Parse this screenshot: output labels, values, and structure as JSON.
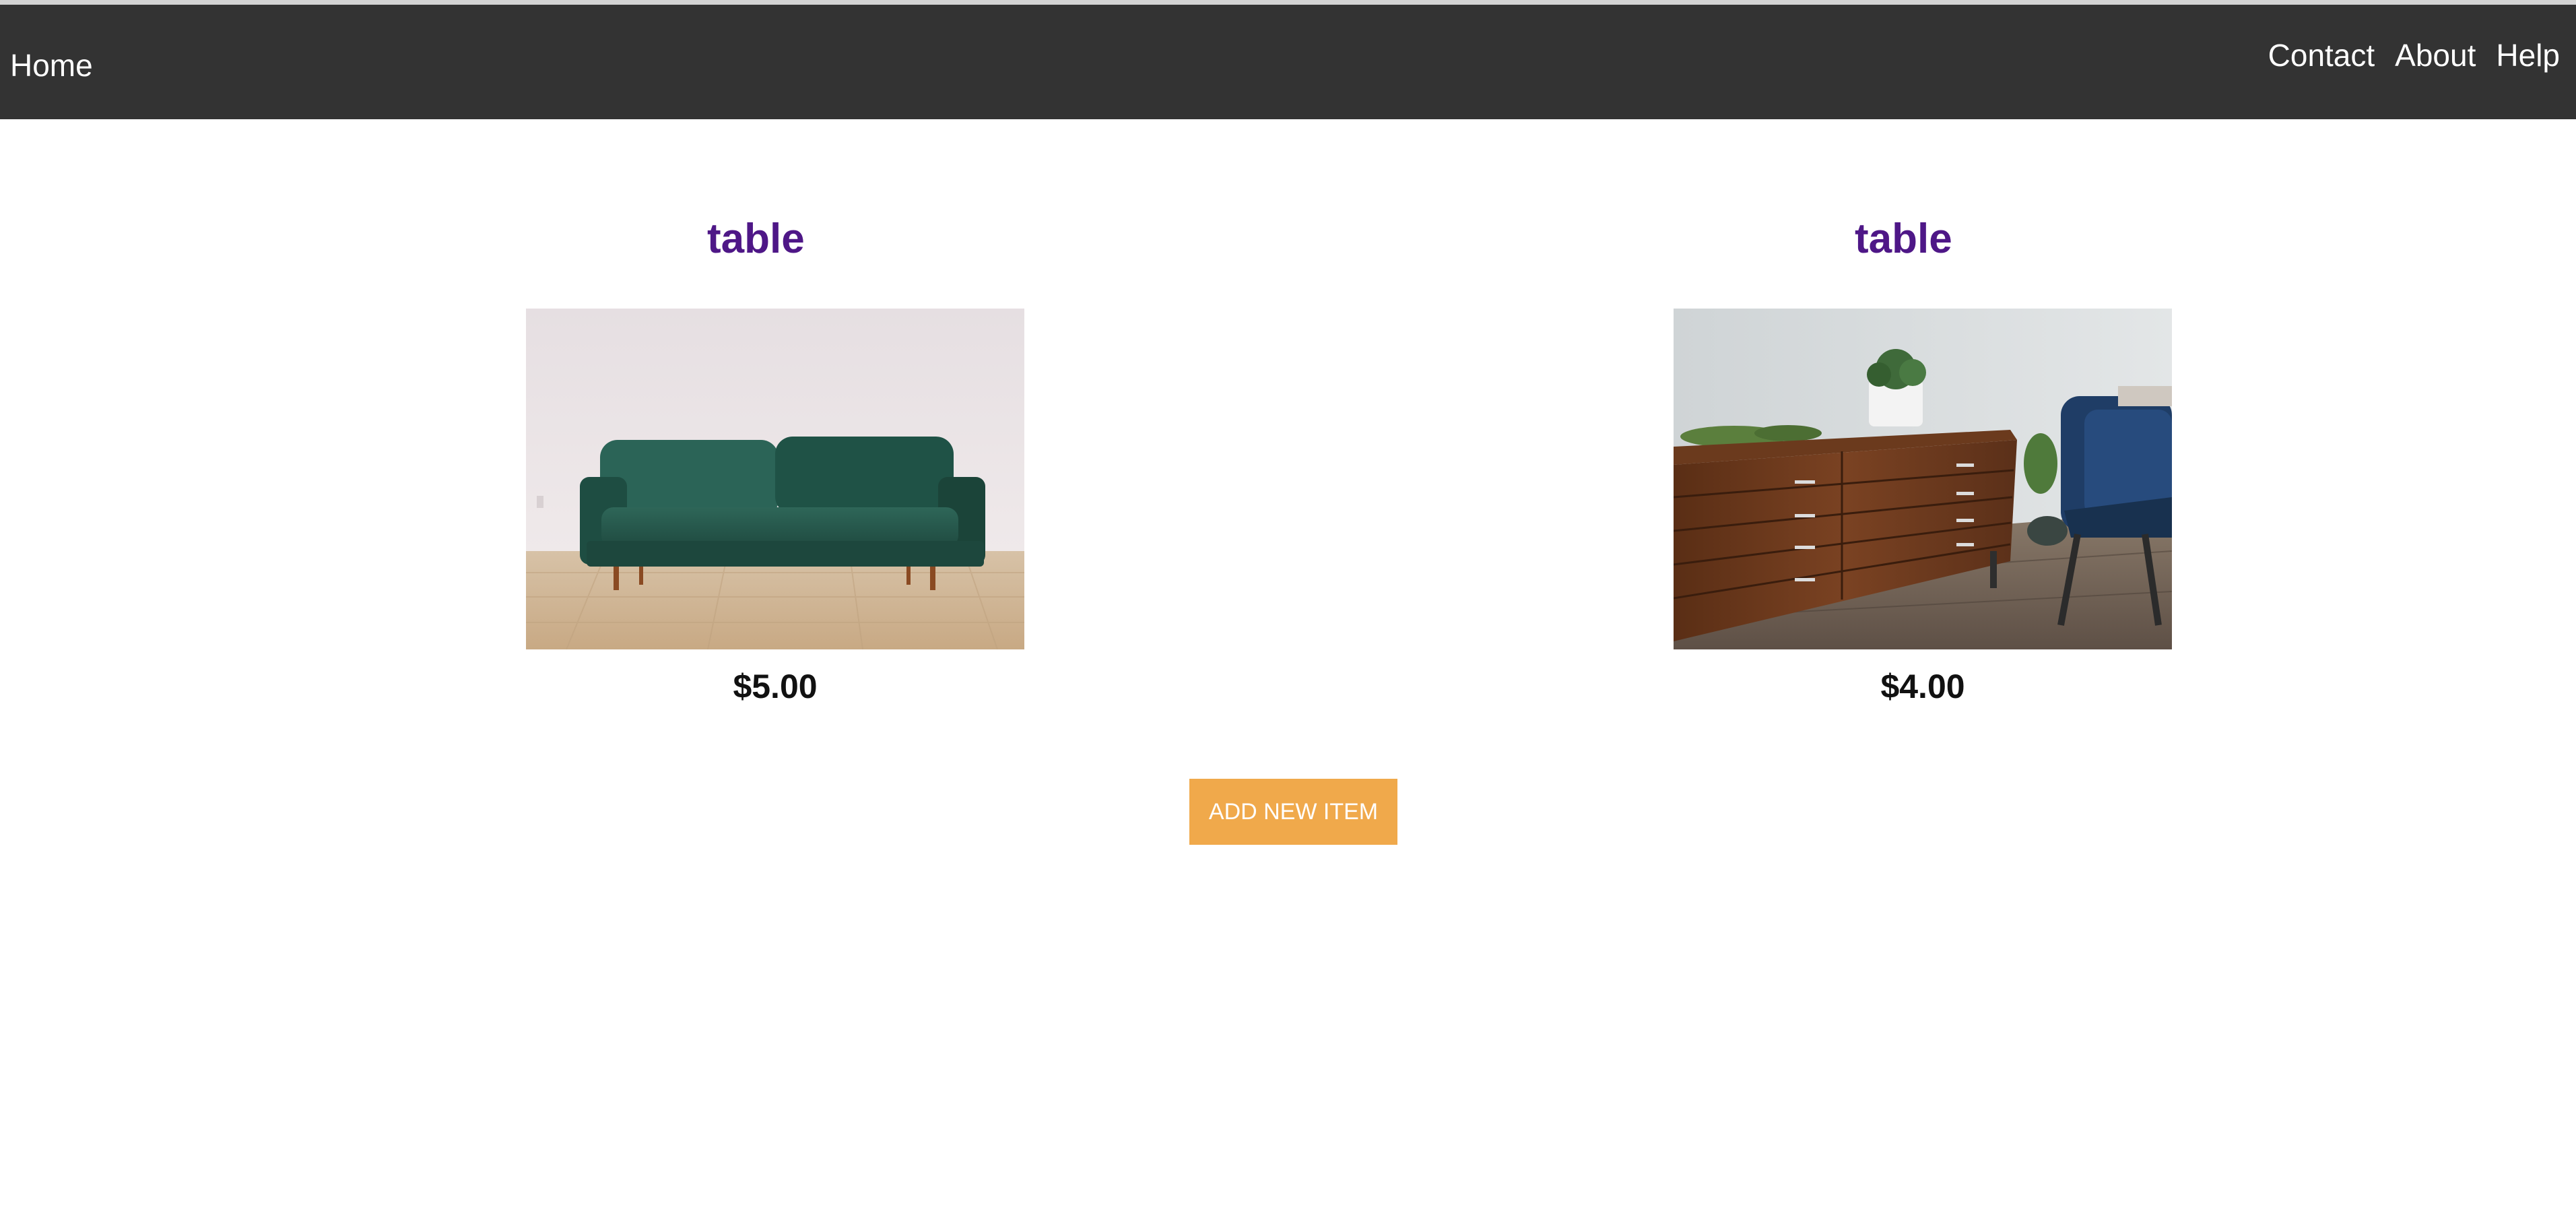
{
  "nav": {
    "home_label": "Home",
    "links": [
      "Contact",
      "About",
      "Help"
    ]
  },
  "items": [
    {
      "title": "table",
      "price": "$5.00",
      "image": "green-velvet-sofa-photo"
    },
    {
      "title": "table",
      "price": "$4.00",
      "image": "wooden-dresser-photo"
    }
  ],
  "actions": {
    "add_label": "ADD NEW ITEM"
  },
  "colors": {
    "navbar": "#333333",
    "title": "#4e1787",
    "button": "#f0a94b"
  }
}
